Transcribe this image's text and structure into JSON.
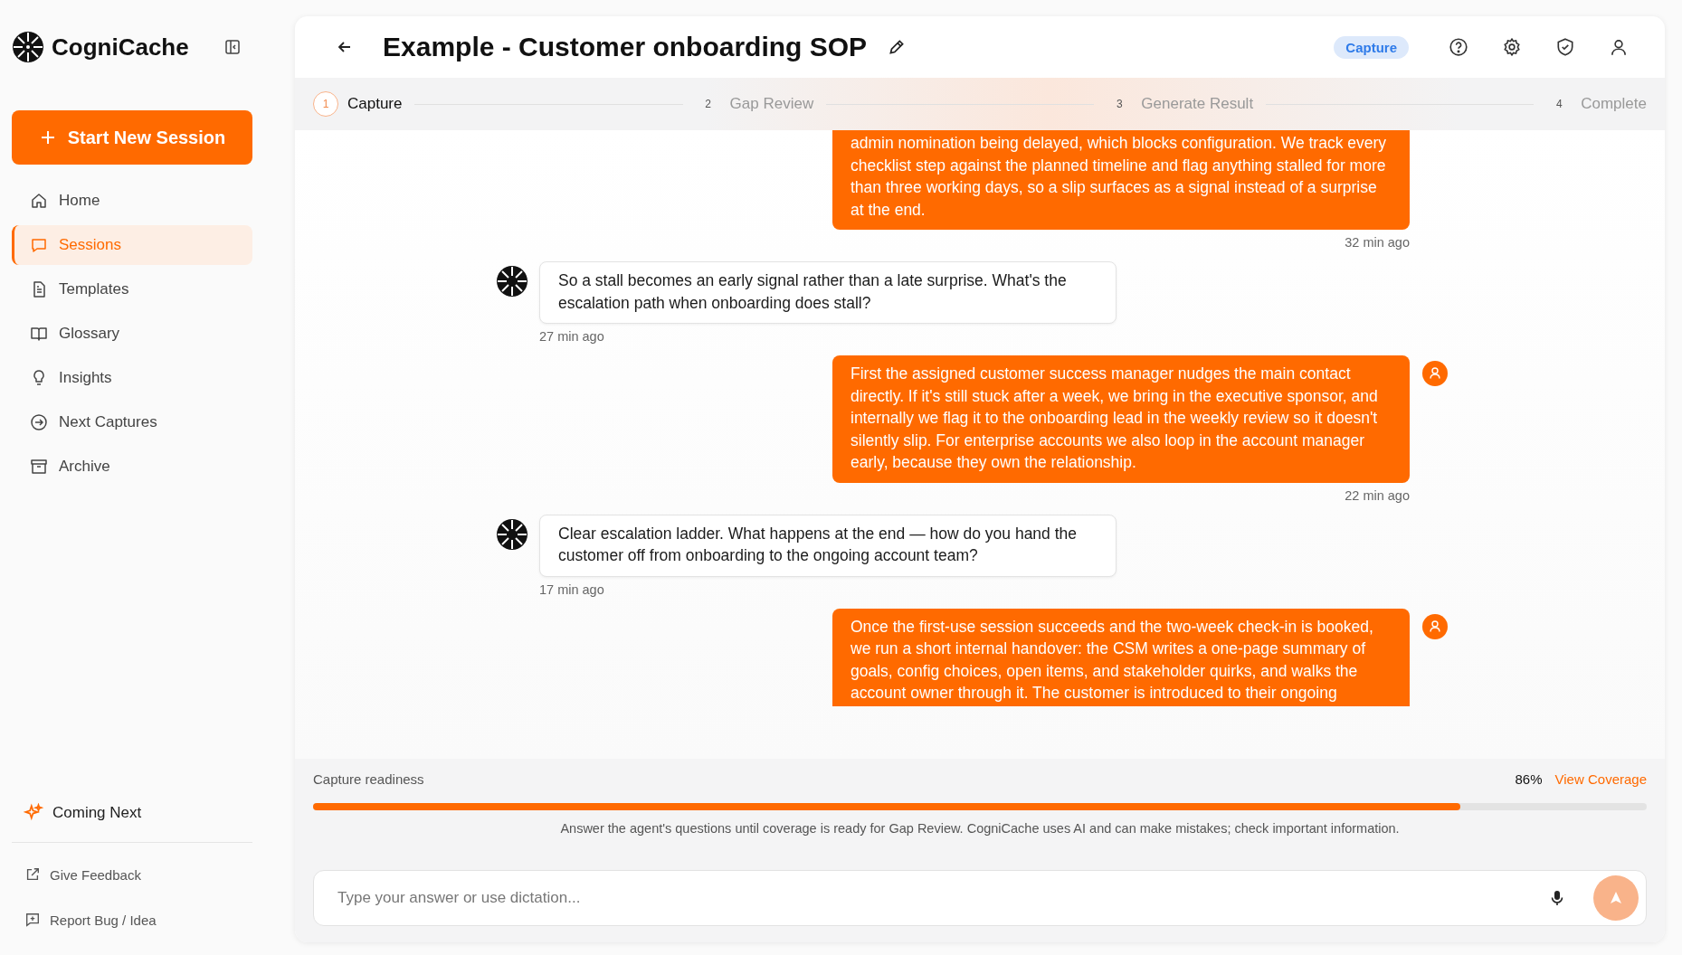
{
  "brand": {
    "name": "CogniCache"
  },
  "new_session_button": {
    "label": "Start New Session"
  },
  "nav": [
    {
      "label": "Home",
      "selected": false
    },
    {
      "label": "Sessions",
      "selected": true
    },
    {
      "label": "Templates",
      "selected": false
    },
    {
      "label": "Glossary",
      "selected": false
    },
    {
      "label": "Insights",
      "selected": false
    },
    {
      "label": "Next Captures",
      "selected": false
    },
    {
      "label": "Archive",
      "selected": false
    }
  ],
  "coming_next": {
    "label": "Coming Next"
  },
  "footer_links": [
    {
      "label": "Give Feedback"
    },
    {
      "label": "Report Bug / Idea"
    }
  ],
  "header": {
    "title": "Example - Customer onboarding SOP",
    "badge": "Capture"
  },
  "steps": [
    {
      "number": "1",
      "label": "Capture",
      "selected": true
    },
    {
      "number": "2",
      "label": "Gap Review",
      "selected": false
    },
    {
      "number": "3",
      "label": "Generate Result",
      "selected": false
    },
    {
      "number": "4",
      "label": "Complete",
      "selected": false
    }
  ],
  "messages": [
    {
      "kind": "user",
      "text": "admin nomination being delayed, which blocks configuration. We track every checklist step against the planned timeline and flag anything stalled for more than three working days, so a slip surfaces as a signal instead of a surprise at the end.",
      "time": "32 min ago",
      "avatar": false
    },
    {
      "kind": "agent",
      "text": "So a stall becomes an early signal rather than a late surprise. What's the escalation path when onboarding does stall?",
      "time": "27 min ago"
    },
    {
      "kind": "user",
      "text": "First the assigned customer success manager nudges the main contact directly. If it's still stuck after a week, we bring in the executive sponsor, and internally we flag it to the onboarding lead in the weekly review so it doesn't silently slip. For enterprise accounts we also loop in the account manager early, because they own the relationship.",
      "time": "22 min ago",
      "avatar": true
    },
    {
      "kind": "agent",
      "text": "Clear escalation ladder. What happens at the end — how do you hand the customer off from onboarding to the ongoing account team?",
      "time": "17 min ago"
    },
    {
      "kind": "user",
      "text": "Once the first-use session succeeds and the two-week check-in is booked, we run a short internal handover: the CSM writes a one-page summary of goals, config choices, open items, and stakeholder quirks, and walks the account owner through it. The customer is introduced to their ongoing",
      "avatar": true
    }
  ],
  "readiness": {
    "label": "Capture readiness",
    "percent": "86%",
    "level": 0.86,
    "link": "View Coverage",
    "note": "Answer the agent's questions until coverage is ready for Gap Review. CogniCache uses AI and can make mistakes; check important information."
  },
  "composer": {
    "placeholder": "Type your answer or use dictation..."
  }
}
